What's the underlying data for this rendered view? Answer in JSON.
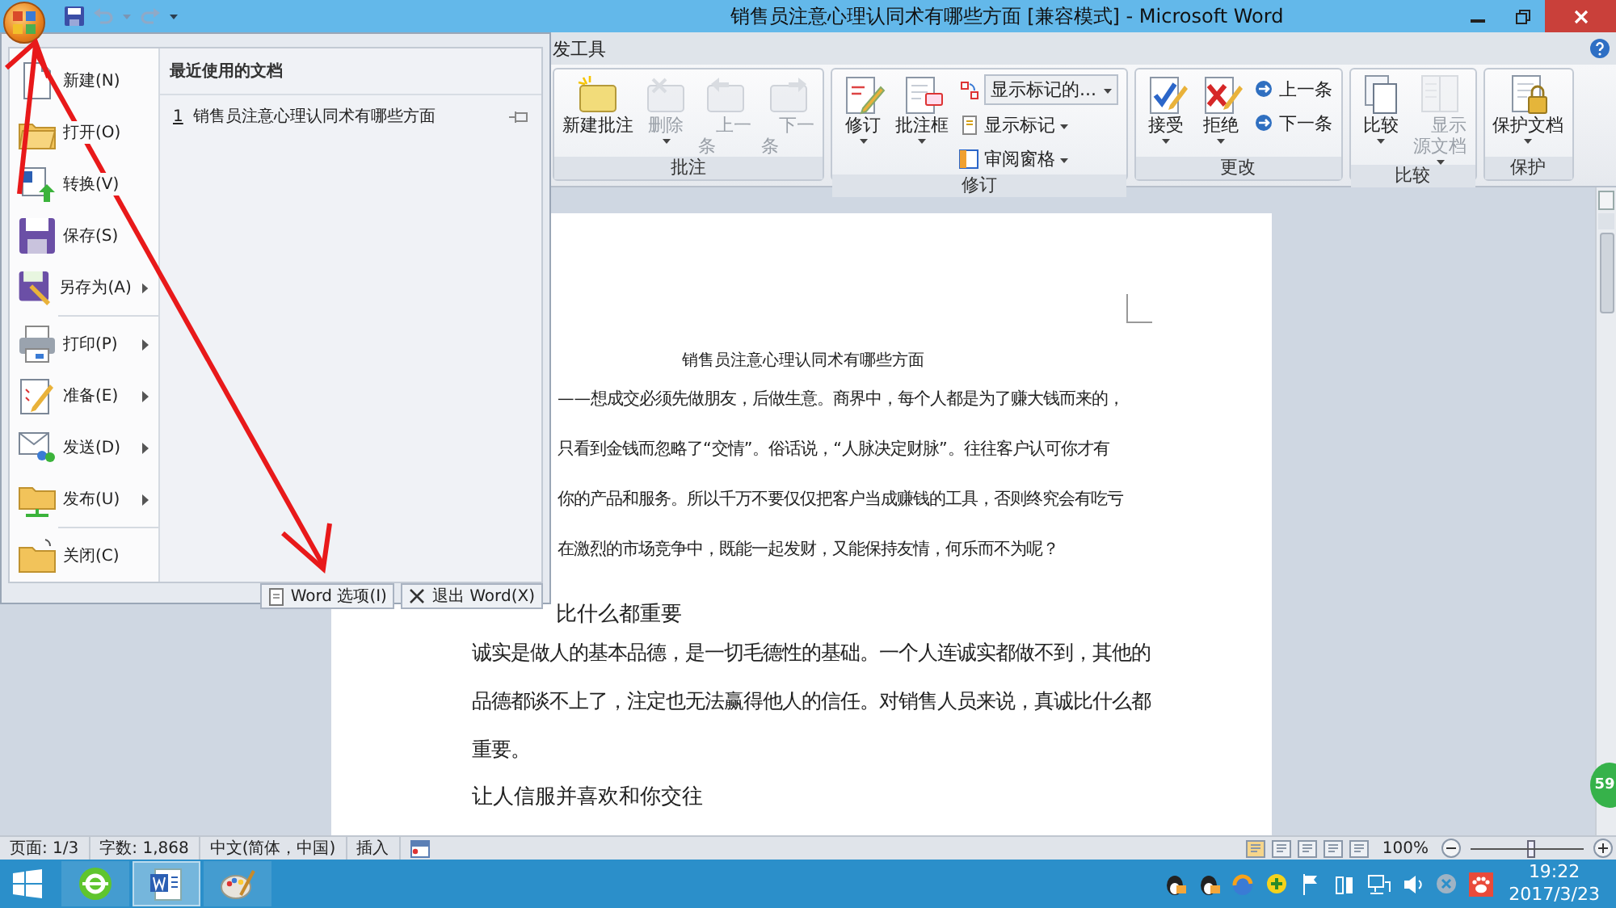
{
  "title_bar": {
    "title": "销售员注意心理认同术有哪些方面 [兼容模式] - Microsoft Word"
  },
  "ribbon": {
    "tab_label": "发工具",
    "groups": [
      {
        "label": "批注",
        "items": [
          {
            "kind": "large",
            "label": "新建批注",
            "disabled": false,
            "dropdown": false
          },
          {
            "kind": "large",
            "label": "删除",
            "disabled": true,
            "dropdown": true
          },
          {
            "kind": "tall",
            "label": "上一条",
            "disabled": true,
            "dropdown": false
          },
          {
            "kind": "tall",
            "label": "下一条",
            "disabled": true,
            "dropdown": false
          }
        ]
      },
      {
        "label": "修订",
        "items": [
          {
            "kind": "large",
            "label": "修订",
            "disabled": false,
            "dropdown": true
          },
          {
            "kind": "large",
            "label": "批注框",
            "disabled": false,
            "dropdown": true
          },
          {
            "kind": "stack",
            "children": [
              {
                "kind": "combo",
                "label": "显示标记的...",
                "disabled": false,
                "dropdown": true
              },
              {
                "kind": "small",
                "label": "显示标记",
                "disabled": false,
                "dropdown": true
              },
              {
                "kind": "small",
                "label": "审阅窗格",
                "disabled": false,
                "dropdown": true
              }
            ]
          }
        ]
      },
      {
        "label": "更改",
        "items": [
          {
            "kind": "large",
            "label": "接受",
            "disabled": false,
            "dropdown": true
          },
          {
            "kind": "large",
            "label": "拒绝",
            "disabled": false,
            "dropdown": true
          },
          {
            "kind": "stack",
            "children": [
              {
                "kind": "small",
                "label": "上一条",
                "disabled": false,
                "dropdown": false
              },
              {
                "kind": "small",
                "label": "下一条",
                "disabled": false,
                "dropdown": false
              }
            ]
          }
        ]
      },
      {
        "label": "比较",
        "items": [
          {
            "kind": "large",
            "label": "比较",
            "disabled": false,
            "dropdown": true
          },
          {
            "kind": "tall",
            "label": "显示源文档",
            "disabled": true,
            "dropdown": true
          }
        ]
      },
      {
        "label": "保护",
        "items": [
          {
            "kind": "large",
            "label": "保护文档",
            "disabled": false,
            "dropdown": true
          }
        ]
      }
    ]
  },
  "office_menu": {
    "items": [
      {
        "label": "新建(N)",
        "submenu": false,
        "separator_before": false
      },
      {
        "label": "打开(O)",
        "submenu": false,
        "separator_before": false
      },
      {
        "label": "转换(V)",
        "submenu": false,
        "separator_before": false
      },
      {
        "label": "保存(S)",
        "submenu": false,
        "separator_before": false
      },
      {
        "label": "另存为(A)",
        "submenu": true,
        "separator_before": false
      },
      {
        "label": "打印(P)",
        "submenu": true,
        "separator_before": true
      },
      {
        "label": "准备(E)",
        "submenu": true,
        "separator_before": false
      },
      {
        "label": "发送(D)",
        "submenu": true,
        "separator_before": false
      },
      {
        "label": "发布(U)",
        "submenu": true,
        "separator_before": false
      },
      {
        "label": "关闭(C)",
        "submenu": false,
        "separator_before": true
      }
    ],
    "recent_title": "最近使用的文档",
    "recent_documents": [
      {
        "number": "1",
        "name": "销售员注意心理认同术有哪些方面"
      }
    ],
    "buttons": [
      "Word 选项(I)",
      "退出 Word(X)"
    ]
  },
  "document": {
    "title": "销售员注意心理认同术有哪些方面",
    "lines": [
      {
        "kind": "covered",
        "text": "——想成交必须先做朋友，后做生意。商界中，每个人都是为了赚大钱而来的，"
      },
      {
        "kind": "covered",
        "text": "只看到金钱而忽略了“交情”。俗话说，“人脉决定财脉”。往往客户认可你才有"
      },
      {
        "kind": "covered",
        "text": "你的产品和服务。所以千万不要仅仅把客户当成赚钱的工具，否则终究会有吃亏"
      },
      {
        "kind": "covered",
        "text": "在激烈的市场竞争中，既能一起发财，又能保持友情，何乐而不为呢？"
      },
      {
        "kind": "heading-covered",
        "text": "比什么都重要"
      },
      {
        "kind": "body",
        "text": "诚实是做人的基本品德，是一切毛德性的基础。一个人连诚实都做不到，其他的"
      },
      {
        "kind": "body",
        "text": "品德都谈不上了，注定也无法赢得他人的信任。对销售人员来说，真诚比什么都"
      },
      {
        "kind": "body",
        "text": "重要。"
      },
      {
        "kind": "heading",
        "text": "让人信服并喜欢和你交往"
      }
    ]
  },
  "badge": {
    "text": "59"
  },
  "status_bar": {
    "items": [
      "页面: 1/3",
      "字数: 1,868",
      "中文(简体，中国)",
      "插入"
    ],
    "zoom": "100%",
    "zoom_slider": {
      "level": 0.5
    }
  },
  "taskbar": {
    "apps": [
      {
        "selected": false
      },
      {
        "selected": true
      },
      {
        "selected": false
      }
    ],
    "time": "19:22",
    "date": "2017/3/23"
  }
}
